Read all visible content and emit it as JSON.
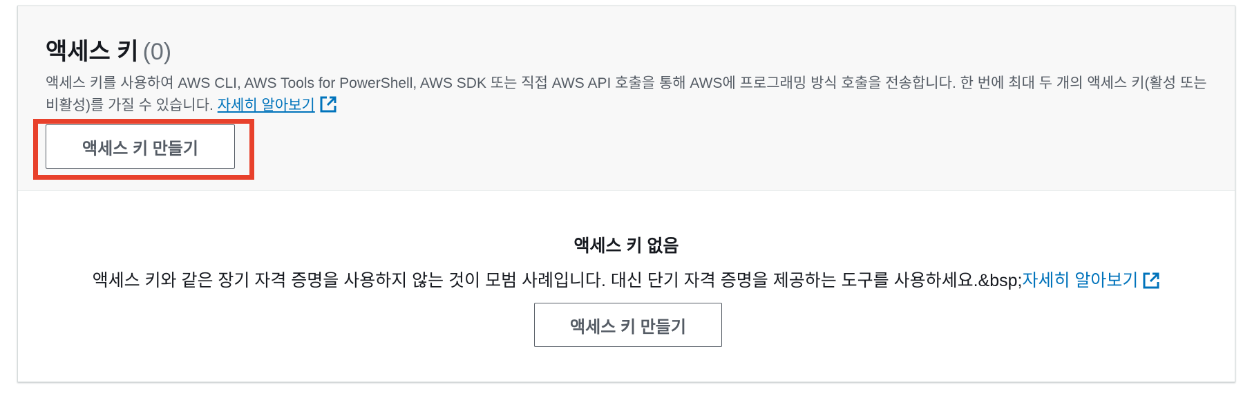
{
  "header": {
    "title": "액세스 키",
    "count": "(0)",
    "description": "액세스 키를 사용하여 AWS CLI, AWS Tools for PowerShell, AWS SDK 또는 직접 AWS API 호출을 통해 AWS에 프로그래밍 방식 호출을 전송합니다. 한 번에 최대 두 개의 액세스 키(활성 또는 비활성)를 가질 수 있습니다.",
    "learn_more": "자세히 알아보기",
    "create_button": "액세스 키 만들기"
  },
  "empty_state": {
    "title": "액세스 키 없음",
    "description": "액세스 키와 같은 장기 자격 증명을 사용하지 않는 것이 모범 사례입니다. 대신 단기 자격 증명을 제공하는 도구를 사용하세요.&bsp;",
    "learn_more": "자세히 알아보기",
    "create_button": "액세스 키 만들기"
  },
  "icons": {
    "external_link": "external-link-icon"
  },
  "colors": {
    "link": "#0073bb",
    "highlight": "#e8412c",
    "header_bg": "#f8f8f8",
    "button_text": "#545b64"
  }
}
